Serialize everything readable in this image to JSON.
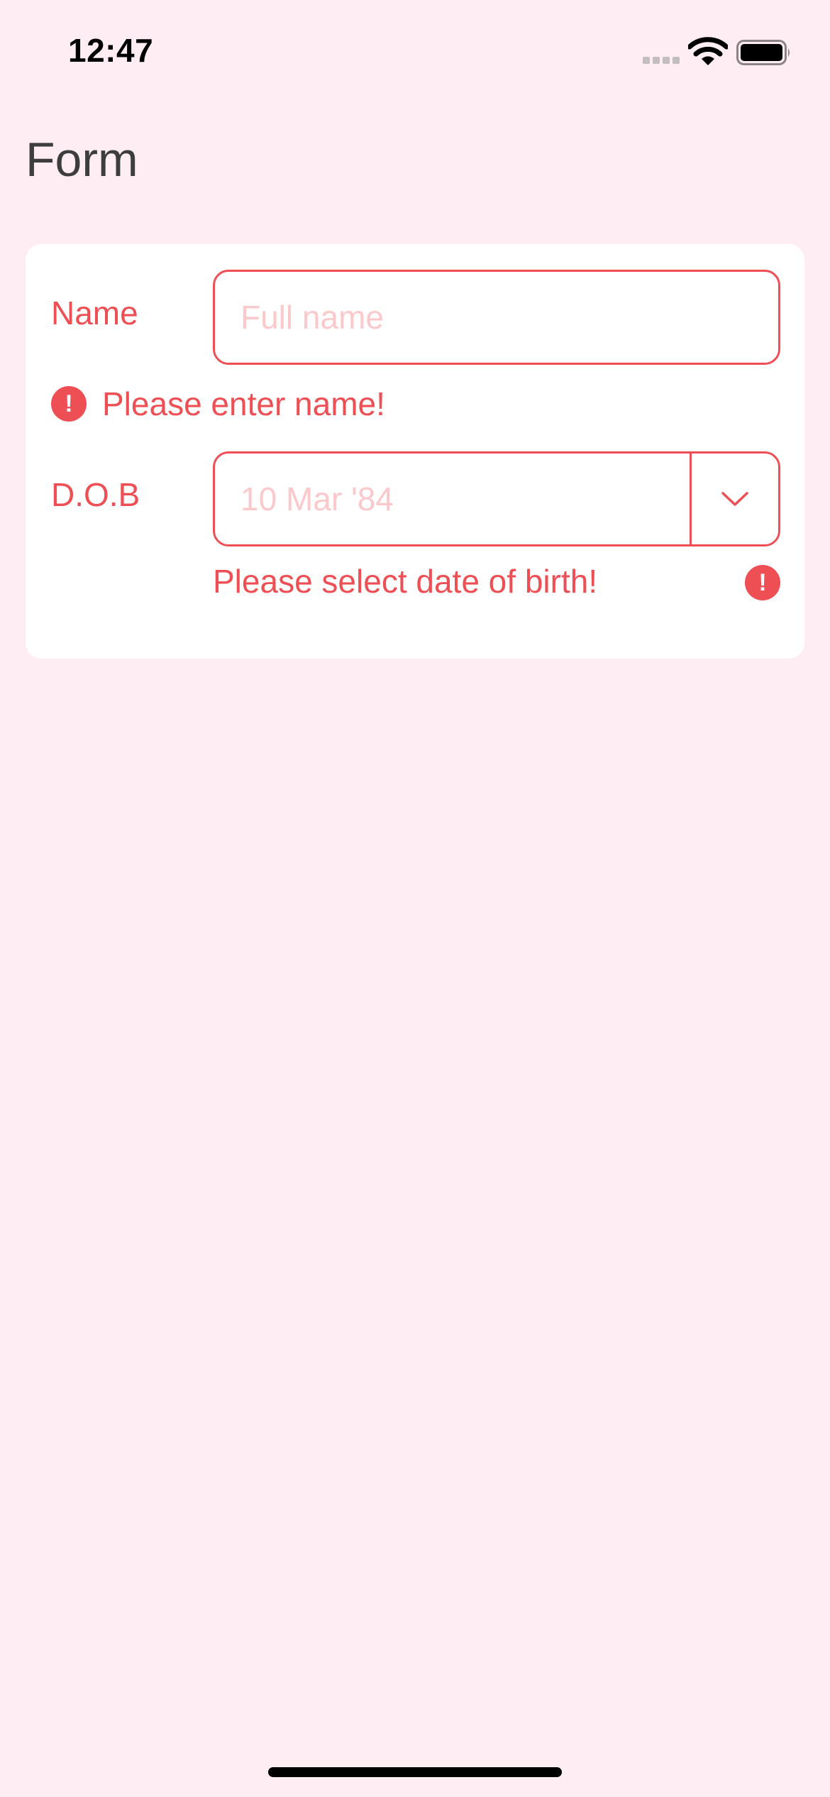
{
  "status_bar": {
    "time": "12:47",
    "icons": [
      "cellular-signal-icon",
      "wifi-icon",
      "battery-icon"
    ]
  },
  "page": {
    "title": "Form"
  },
  "form": {
    "name": {
      "label": "Name",
      "placeholder": "Full name",
      "value": "",
      "error": "Please enter name!"
    },
    "dob": {
      "label": "D.O.B",
      "placeholder": "10 Mar '84",
      "error": "Please select date of birth!"
    },
    "error_icon_glyph": "!"
  },
  "colors": {
    "background": "#FEEEF3",
    "card": "#FFFFFF",
    "error": "#EE4F55",
    "placeholder": "#FBC9CB",
    "title": "#3D3D3D"
  }
}
